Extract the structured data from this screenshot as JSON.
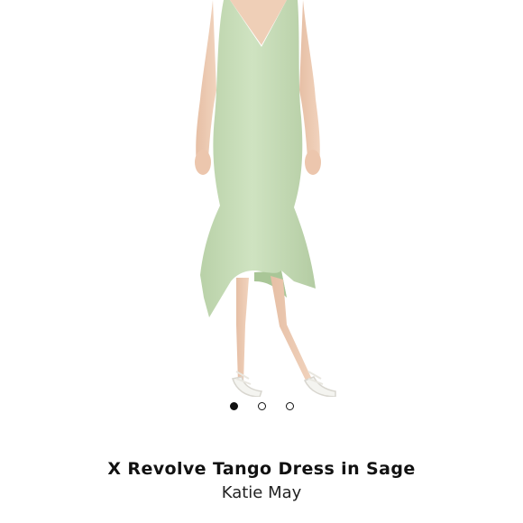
{
  "product": {
    "title": "X Revolve Tango Dress in Sage",
    "brand": "Katie May",
    "color": "#c6dcb7",
    "image_icon": "product-photo-dress"
  },
  "carousel": {
    "total": 3,
    "active_index": 0
  }
}
